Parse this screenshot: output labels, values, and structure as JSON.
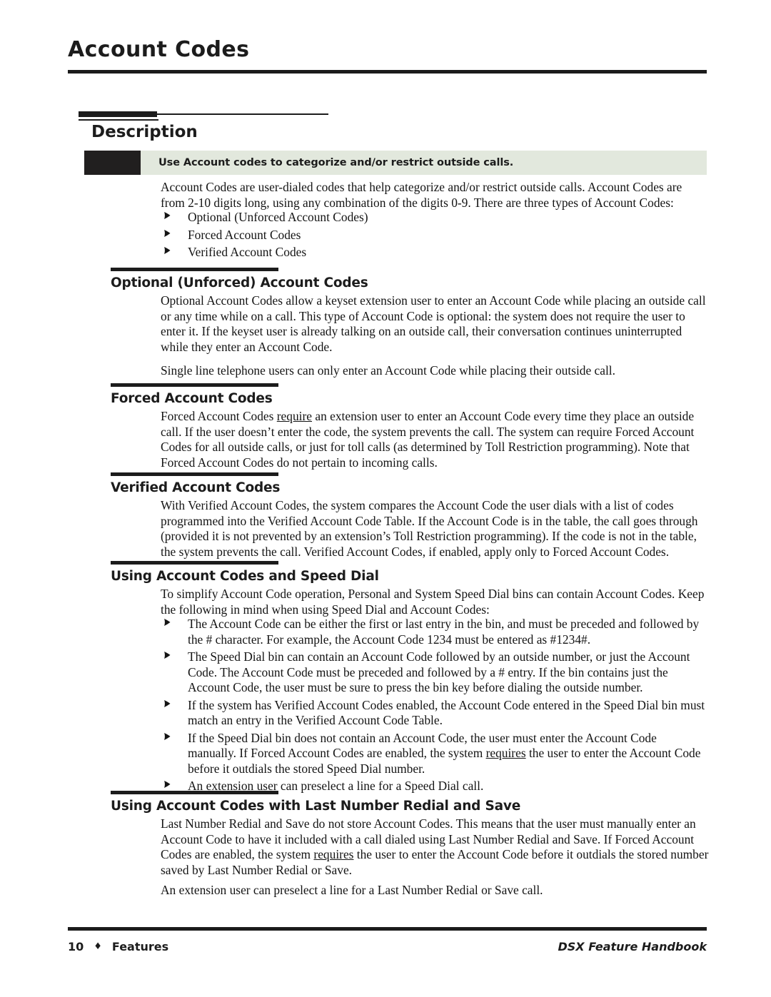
{
  "page": {
    "title": "Account Codes"
  },
  "section": {
    "heading": "Description",
    "callout": "Use Account codes to categorize and/or restrict outside calls.",
    "intro": "Account Codes are user-dialed codes that help categorize and/or restrict outside calls. Account Codes are from 2-10 digits long, using any combination of the digits 0-9. There are three types of Account Codes:",
    "intro_bullets": [
      "Optional (Unforced Account Codes)",
      "Forced Account Codes",
      "Verified Account Codes"
    ]
  },
  "subsections": [
    {
      "heading": "Optional (Unforced) Account Codes",
      "para1": "Optional Account Codes allow a keyset extension user to enter an Account Code while placing an outside call or any time while on a call. This type of Account Code is optional: the system does not require the user to enter it. If the keyset user is already talking on an outside call, their conversation continues uninterrupted while they enter an Account Code.",
      "para2": "Single line telephone users can only enter an Account Code while placing their outside call."
    },
    {
      "heading": "Forced Account Codes",
      "para1_a": "Forced Account Codes ",
      "para1_u": "require",
      "para1_b": " an extension user to enter an Account Code every time they place an outside call. If the user doesn’t enter the code, the system prevents the call. The system can require Forced Account Codes for all outside calls, or just for toll calls (as determined by Toll Restriction programming). Note that Forced Account Codes do not pertain to incoming calls."
    },
    {
      "heading": "Verified Account Codes",
      "para1": "With Verified Account Codes, the system compares the Account Code the user dials with a list of codes programmed into the Verified Account Code Table. If the Account Code is in the table, the call goes through (provided it is not prevented by an extension’s Toll Restriction programming). If the code is not in the table, the system prevents the call. Verified Account Codes, if enabled, apply only to Forced Account Codes."
    },
    {
      "heading": "Using Account Codes and Speed Dial",
      "para1": "To simplify Account Code operation, Personal and System Speed Dial bins can contain Account Codes. Keep the following in mind when using Speed Dial and Account Codes:",
      "bullets": [
        {
          "a": "The Account Code can be either the first or last entry in the bin, and must be preceded and followed by the # character. For example, the Account Code 1234 must be entered as #1234#.",
          "u": "",
          "b": ""
        },
        {
          "a": "The Speed Dial bin can contain an Account Code followed by an outside number, or just the Account Code. The Account Code must be preceded and followed by a # entry. If the bin contains just the Account Code, the user must be sure to press the bin key before dialing the outside number.",
          "u": "",
          "b": ""
        },
        {
          "a": "If the system has Verified Account Codes enabled, the Account Code entered in the Speed Dial bin must match an entry in the Verified Account Code Table.",
          "u": "",
          "b": ""
        },
        {
          "a": "If the Speed Dial bin does not contain an Account Code, the user must enter the Account Code manually. If Forced Account Codes are enabled, the system ",
          "u": "requires",
          "b": " the user to enter the Account Code before it outdials the stored Speed Dial number."
        },
        {
          "a": "An extension user can preselect a line for a Speed Dial call.",
          "u": "",
          "b": ""
        }
      ]
    },
    {
      "heading": "Using Account Codes with Last Number Redial and Save",
      "para1_a": "Last Number Redial and Save do not store Account Codes. This means that the user must manually enter an Account Code to have it included with a call dialed using Last Number Redial and Save. If Forced Account Codes are enabled, the system ",
      "para1_u": "requires",
      "para1_b": " the user to enter the Account Code before it outdials the stored number saved by Last Number Redial or Save.",
      "para2": "An extension user can preselect a line for a Last Number Redial or Save call."
    }
  ],
  "footer": {
    "page_number": "10",
    "separator": "♦",
    "section_name": "Features",
    "book_title": "DSX Feature Handbook"
  },
  "colors": {
    "ink": "#1c1c1c",
    "callout_block": "#211f1f",
    "callout_band": "#e2e8dd"
  }
}
